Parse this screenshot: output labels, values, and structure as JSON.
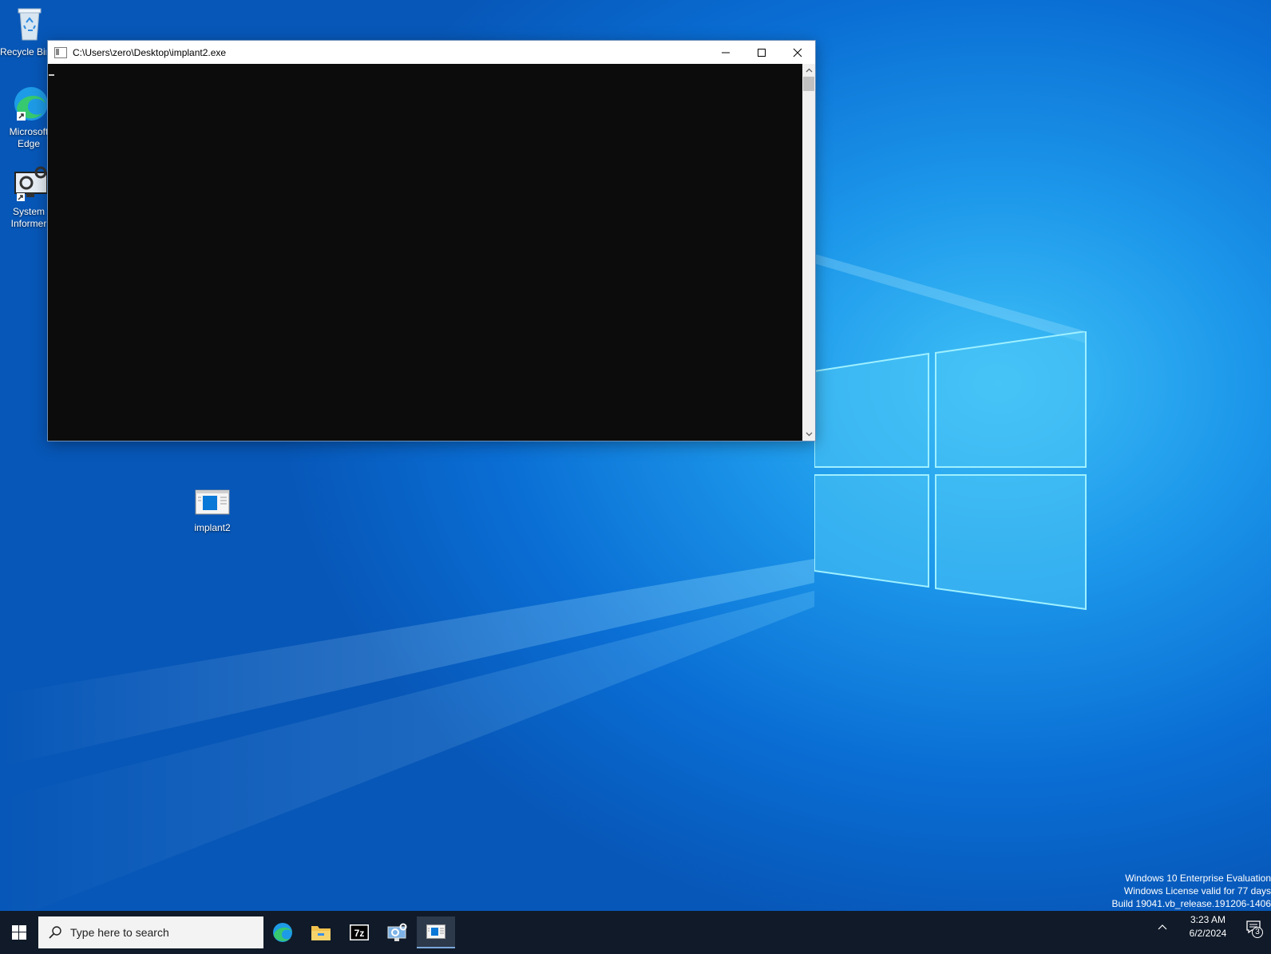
{
  "desktop": {
    "icons": [
      {
        "label": "Recycle Bin"
      },
      {
        "label": "Microsoft Edge"
      },
      {
        "label": "System Informer"
      },
      {
        "label": "implant2"
      }
    ],
    "watermark": {
      "line1": "Windows 10 Enterprise Evaluation",
      "line2": "Windows License valid for 77 days",
      "line3": "Build 19041.vb_release.191206-1406"
    }
  },
  "window": {
    "title": "C:\\Users\\zero\\Desktop\\implant2.exe",
    "console_text": ""
  },
  "taskbar": {
    "search_placeholder": "Type here to search",
    "apps": [
      "edge-icon",
      "file-explorer-icon",
      "7zip-icon",
      "system-informer-icon",
      "console-app-icon"
    ],
    "time": "3:23 AM",
    "date": "6/2/2024",
    "notification_count": "3"
  },
  "colors": {
    "console_bg": "#0c0c0c",
    "taskbar_bg": "#101a28",
    "accent": "#0a78d7"
  }
}
